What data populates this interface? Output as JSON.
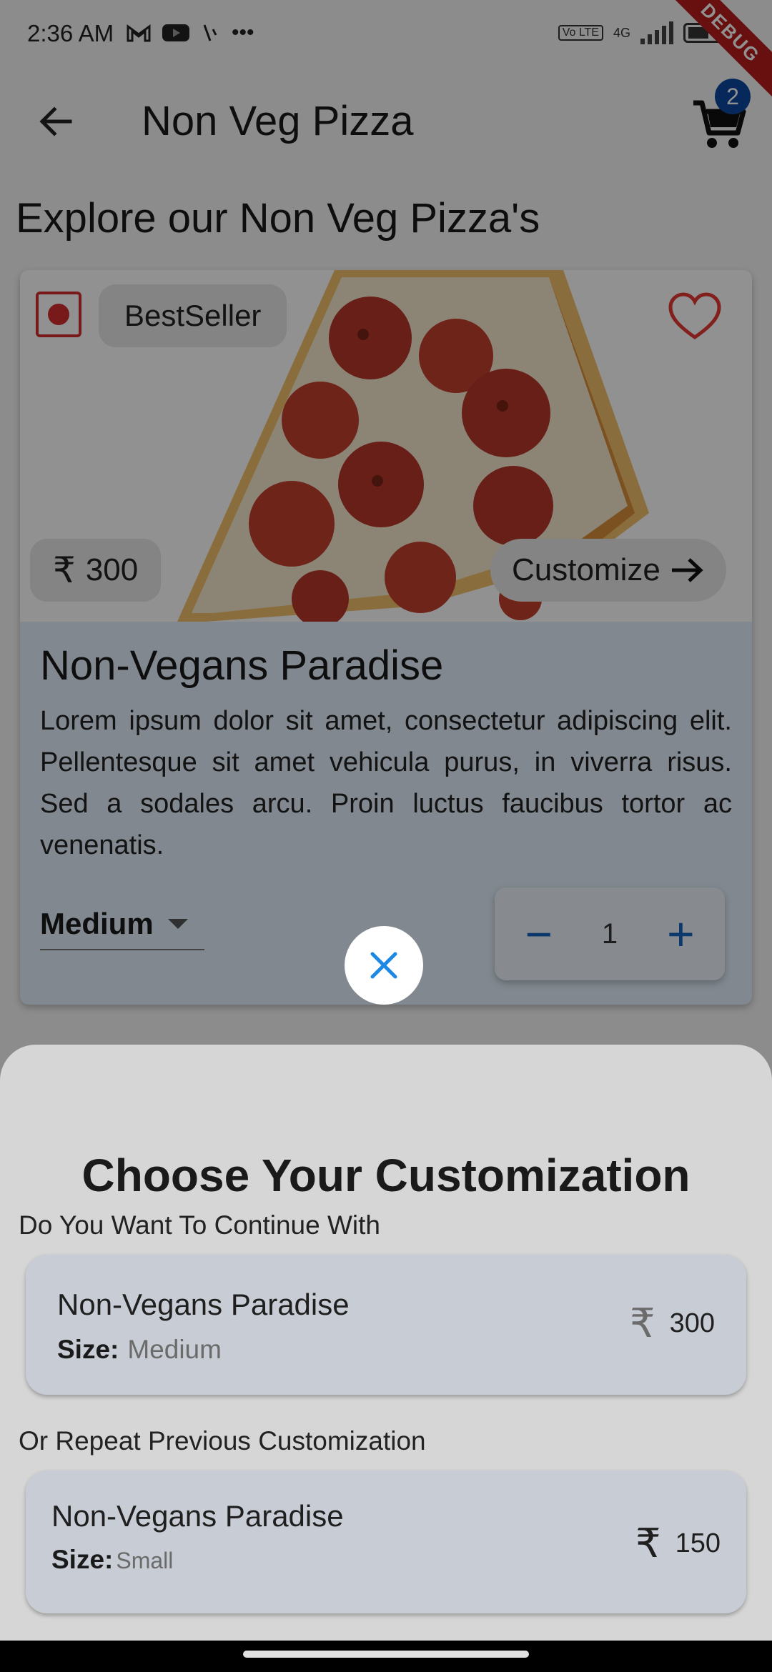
{
  "status_bar": {
    "time": "2:36 AM",
    "indicators": [
      "gmail-icon",
      "youtube-icon",
      "signal-slash-icon",
      "more-dots-icon"
    ],
    "volte": "Vo LTE",
    "network": "4G",
    "debug_banner": "DEBUG"
  },
  "app_bar": {
    "title": "Non Veg Pizza",
    "cart_count": "2"
  },
  "section_heading": "Explore our Non Veg Pizza's",
  "product_card": {
    "badge": "BestSeller",
    "price_symbol": "₹",
    "price": "300",
    "customize_label": "Customize",
    "title": "Non-Vegans Paradise",
    "description": "Lorem ipsum dolor sit amet, consectetur adipiscing elit. Pellentesque sit amet vehicula purus, in viverra risus. Sed a sodales arcu. Proin luctus faucibus tortor ac venenatis.",
    "size": "Medium",
    "quantity": "1",
    "minus": "−",
    "plus": "+"
  },
  "sheet": {
    "title": "Choose Your Customization",
    "continue_prompt": "Do You Want To Continue With",
    "repeat_prompt": "Or Repeat Previous Customization",
    "options": [
      {
        "name": "Non-Vegans Paradise",
        "size_key": "Size:",
        "size": "Medium",
        "currency": "₹",
        "price": "300"
      },
      {
        "name": "Non-Vegans Paradise",
        "size_key": "Size:",
        "size": "Small",
        "currency": "₹",
        "price": "150"
      }
    ]
  },
  "colors": {
    "accent": "#1565c0",
    "badge": "#0d47a1",
    "nonveg": "#d32f2f",
    "card_bg": "#e3f0fc",
    "sheet_bg": "#d6d6d6",
    "option_bg": "#c8ccd4"
  }
}
